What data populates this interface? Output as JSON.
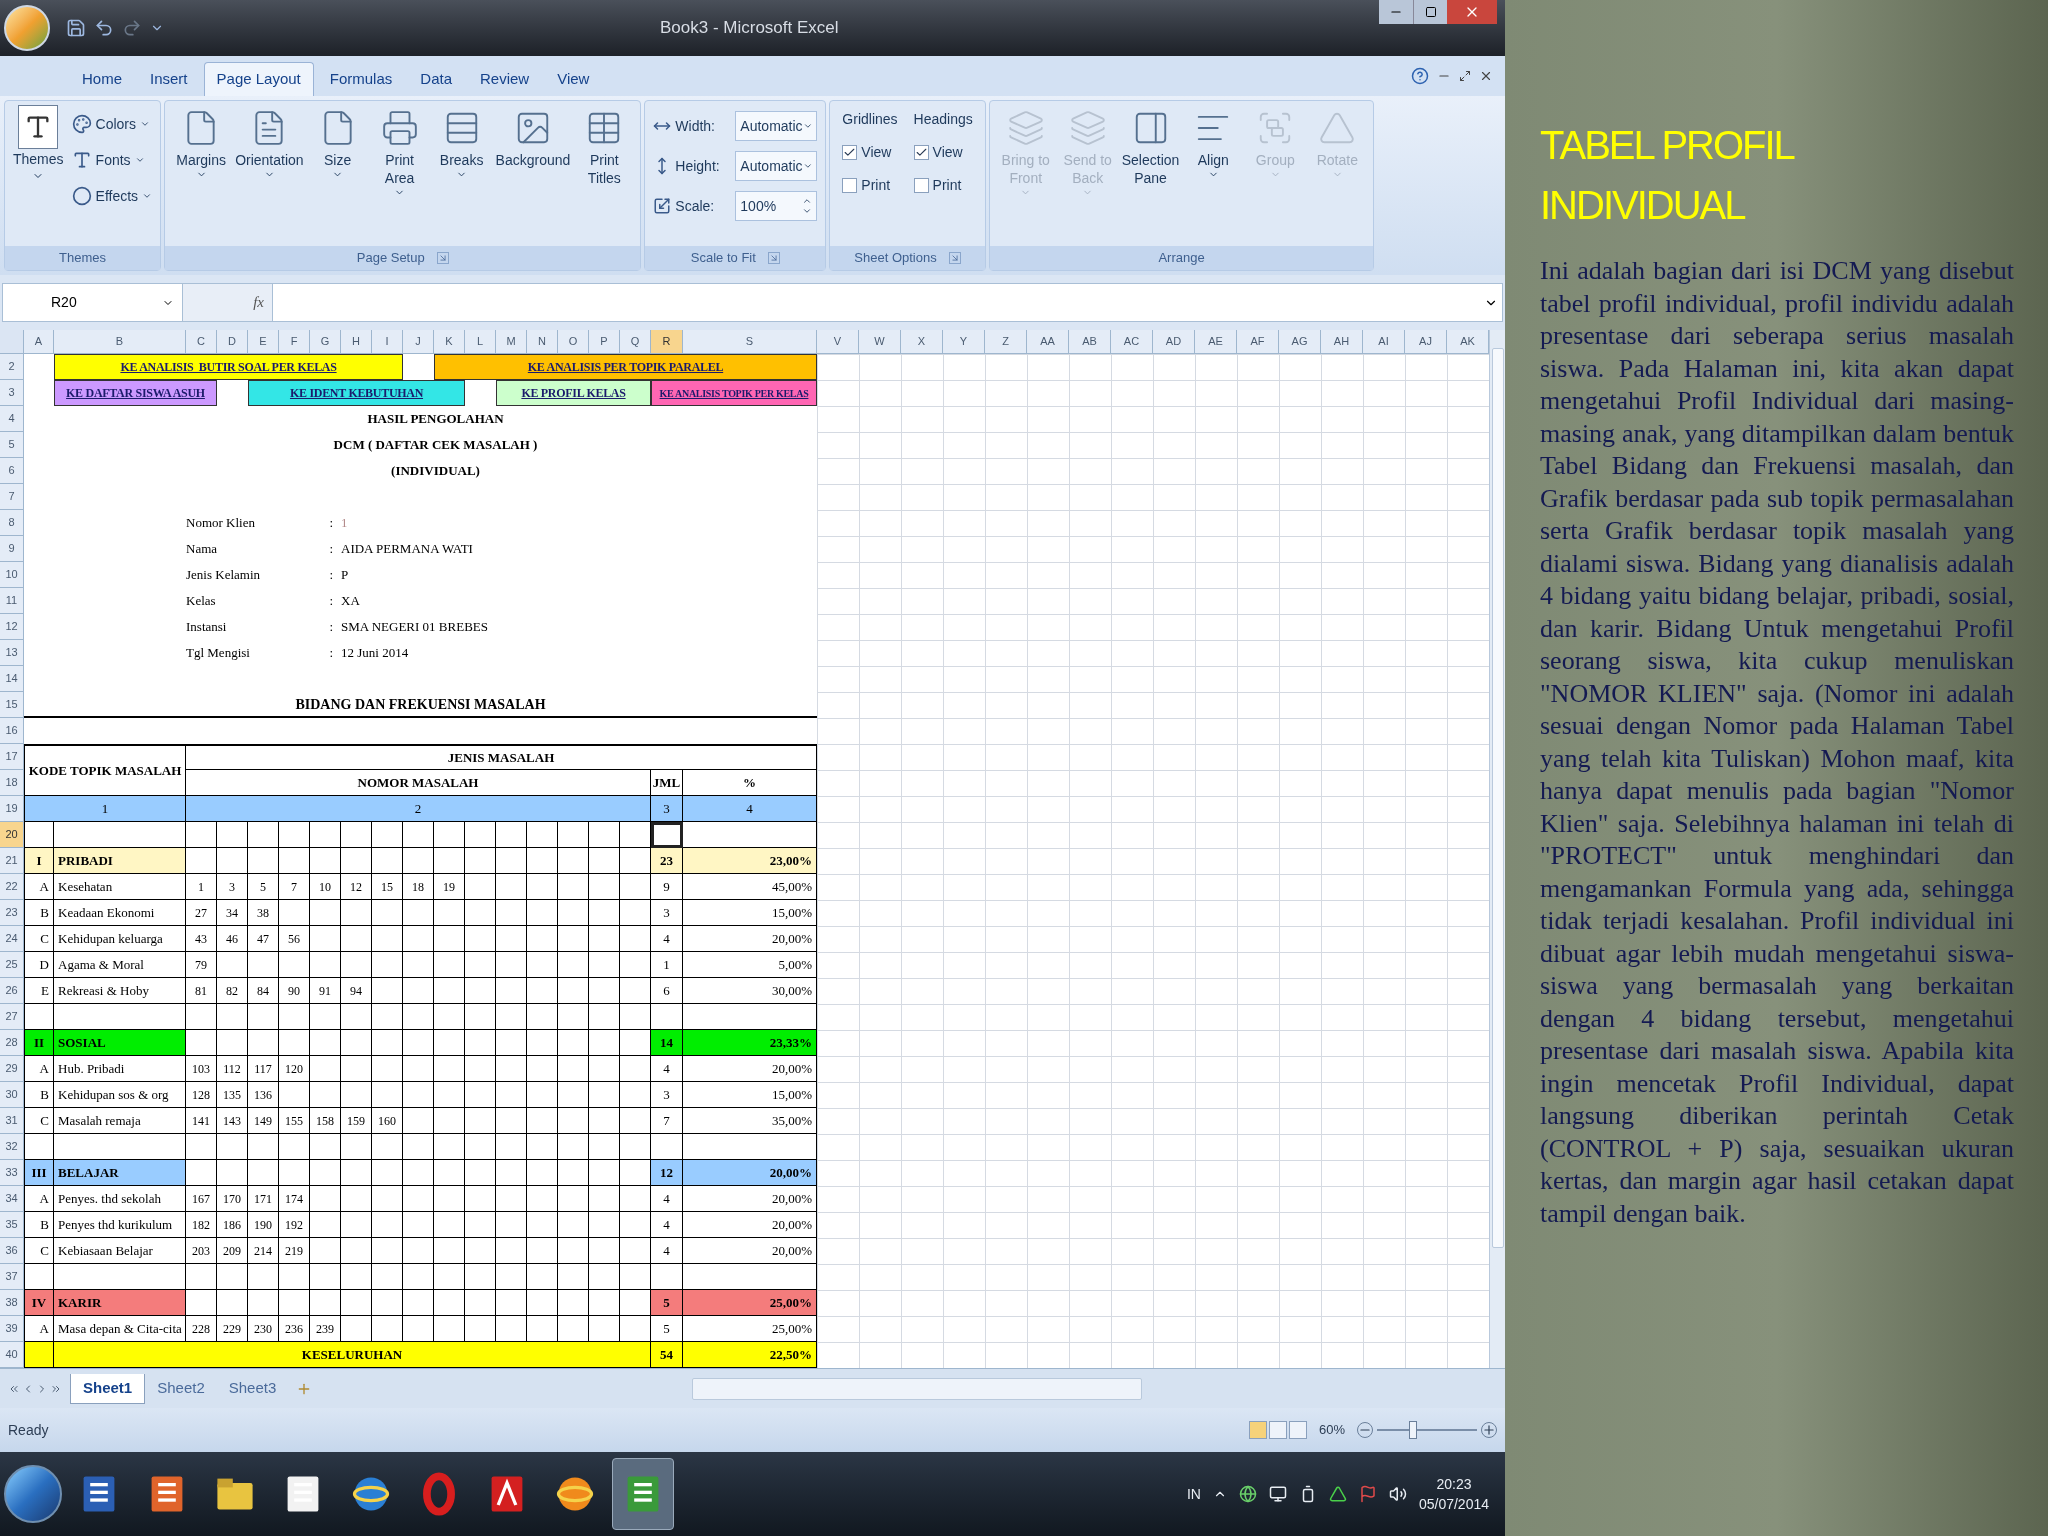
{
  "window": {
    "title": "Book3 - Microsoft Excel"
  },
  "ribbon_tabs": [
    {
      "label": "Home",
      "selected": false
    },
    {
      "label": "Insert",
      "selected": false
    },
    {
      "label": "Page Layout",
      "selected": true
    },
    {
      "label": "Formulas",
      "selected": false
    },
    {
      "label": "Data",
      "selected": false
    },
    {
      "label": "Review",
      "selected": false
    },
    {
      "label": "View",
      "selected": false
    }
  ],
  "ribbon_groups": [
    {
      "kind": "themes",
      "label": "Themes",
      "main": "Themes",
      "menus": [
        "Colors",
        "Fonts",
        "Effects"
      ]
    },
    {
      "kind": "buttons",
      "label": "Page Setup",
      "launcher": true,
      "buttons": [
        {
          "label": "Margins",
          "has_menu": true,
          "disabled": false
        },
        {
          "label": "Orientation",
          "has_menu": true,
          "disabled": false
        },
        {
          "label": "Size",
          "has_menu": true,
          "disabled": false
        },
        {
          "label": "Print Area",
          "has_menu": true,
          "disabled": false
        },
        {
          "label": "Breaks",
          "has_menu": true,
          "disabled": false
        },
        {
          "label": "Background",
          "has_menu": false,
          "disabled": false
        },
        {
          "label": "Print Titles",
          "has_menu": false,
          "disabled": false
        }
      ]
    },
    {
      "kind": "scale",
      "label": "Scale to Fit",
      "launcher": true,
      "fields": [
        {
          "kind": "dropdown",
          "label": "Width:",
          "value": "Automatic"
        },
        {
          "kind": "dropdown",
          "label": "Height:",
          "value": "Automatic"
        },
        {
          "kind": "spinner",
          "label": "Scale:",
          "value": "100%"
        }
      ]
    },
    {
      "kind": "sheet_options",
      "label": "Sheet Options",
      "launcher": true,
      "columns": [
        {
          "title": "Gridlines",
          "checks": [
            {
              "label": "View",
              "checked": true
            },
            {
              "label": "Print",
              "checked": false
            }
          ]
        },
        {
          "title": "Headings",
          "checks": [
            {
              "label": "View",
              "checked": true
            },
            {
              "label": "Print",
              "checked": false
            }
          ]
        }
      ]
    },
    {
      "kind": "buttons",
      "label": "Arrange",
      "launcher": false,
      "buttons": [
        {
          "label": "Bring to Front",
          "has_menu": true,
          "disabled": true
        },
        {
          "label": "Send to Back",
          "has_menu": true,
          "disabled": true
        },
        {
          "label": "Selection Pane",
          "has_menu": false,
          "disabled": false
        },
        {
          "label": "Align",
          "has_menu": true,
          "disabled": false
        },
        {
          "label": "Group",
          "has_menu": true,
          "disabled": true
        },
        {
          "label": "Rotate",
          "has_menu": true,
          "disabled": true
        }
      ]
    }
  ],
  "formula_bar": {
    "name_box": "R20",
    "fx": "fx"
  },
  "sheet": {
    "column_headers": [
      {
        "label": "A",
        "selected": false
      },
      {
        "label": "B",
        "selected": false
      },
      {
        "label": "C",
        "selected": false
      },
      {
        "label": "D",
        "selected": false
      },
      {
        "label": "E",
        "selected": false
      },
      {
        "label": "F",
        "selected": false
      },
      {
        "label": "G",
        "selected": false
      },
      {
        "label": "H",
        "selected": false
      },
      {
        "label": "I",
        "selected": false
      },
      {
        "label": "J",
        "selected": false
      },
      {
        "label": "K",
        "selected": false
      },
      {
        "label": "L",
        "selected": false
      },
      {
        "label": "M",
        "selected": false
      },
      {
        "label": "N",
        "selected": false
      },
      {
        "label": "O",
        "selected": false
      },
      {
        "label": "P",
        "selected": false
      },
      {
        "label": "Q",
        "selected": false
      },
      {
        "label": "R",
        "selected": true
      },
      {
        "label": "S",
        "selected": false
      },
      {
        "label": "V",
        "selected": false
      },
      {
        "label": "W",
        "selected": false
      },
      {
        "label": "X",
        "selected": false
      },
      {
        "label": "Y",
        "selected": false
      },
      {
        "label": "Z",
        "selected": false
      },
      {
        "label": "AA",
        "selected": false
      },
      {
        "label": "AB",
        "selected": false
      },
      {
        "label": "AC",
        "selected": false
      },
      {
        "label": "AD",
        "selected": false
      },
      {
        "label": "AE",
        "selected": false
      },
      {
        "label": "AF",
        "selected": false
      },
      {
        "label": "AG",
        "selected": false
      },
      {
        "label": "AH",
        "selected": false
      },
      {
        "label": "AI",
        "selected": false
      },
      {
        "label": "AJ",
        "selected": false
      },
      {
        "label": "AK",
        "selected": false
      }
    ],
    "row_headers": [
      {
        "label": "2",
        "selected": false
      },
      {
        "label": "3",
        "selected": false
      },
      {
        "label": "4",
        "selected": false
      },
      {
        "label": "5",
        "selected": false
      },
      {
        "label": "6",
        "selected": false
      },
      {
        "label": "7",
        "selected": false
      },
      {
        "label": "8",
        "selected": false
      },
      {
        "label": "9",
        "selected": false
      },
      {
        "label": "10",
        "selected": false
      },
      {
        "label": "11",
        "selected": false
      },
      {
        "label": "12",
        "selected": false
      },
      {
        "label": "13",
        "selected": false
      },
      {
        "label": "14",
        "selected": false
      },
      {
        "label": "15",
        "selected": false
      },
      {
        "label": "16",
        "selected": false
      },
      {
        "label": "17",
        "selected": false
      },
      {
        "label": "18",
        "selected": false
      },
      {
        "label": "19",
        "selected": false
      },
      {
        "label": "20",
        "selected": true
      },
      {
        "label": "21",
        "selected": false
      },
      {
        "label": "22",
        "selected": false
      },
      {
        "label": "23",
        "selected": false
      },
      {
        "label": "24",
        "selected": false
      },
      {
        "label": "25",
        "selected": false
      },
      {
        "label": "26",
        "selected": false
      },
      {
        "label": "27",
        "selected": false
      },
      {
        "label": "28",
        "selected": false
      },
      {
        "label": "29",
        "selected": false
      },
      {
        "label": "30",
        "selected": false
      },
      {
        "label": "31",
        "selected": false
      },
      {
        "label": "32",
        "selected": false
      },
      {
        "label": "33",
        "selected": false
      },
      {
        "label": "34",
        "selected": false
      },
      {
        "label": "35",
        "selected": false
      },
      {
        "label": "36",
        "selected": false
      },
      {
        "label": "37",
        "selected": false
      },
      {
        "label": "38",
        "selected": false
      },
      {
        "label": "39",
        "selected": false
      },
      {
        "label": "40",
        "selected": false
      }
    ],
    "links": [
      {
        "label": "KE ANALISIS  BUTIR SOAL PER KELAS",
        "color": "#ffff00"
      },
      {
        "label": "KE ANALISIS PER TOPIK PARALEL",
        "color": "#ffc000"
      },
      {
        "label": "KE DAFTAR SISWA ASUH",
        "color": "#cc99ff"
      },
      {
        "label": "KE IDENT KEBUTUHAN",
        "color": "#33e6e6"
      },
      {
        "label": "KE PROFIL KELAS",
        "color": "#ccffcc"
      },
      {
        "label": "KE ANALISIS TOPIK PER KELAS",
        "color": "#ff66b3"
      }
    ],
    "report_title": [
      "HASIL PENGOLAHAN",
      "DCM ( DAFTAR CEK MASALAH )",
      "(INDIVIDUAL)"
    ],
    "client_info": [
      {
        "label": "Nomor Klien",
        "separator": ":",
        "value": "1"
      },
      {
        "label": "Nama",
        "separator": ":",
        "value": "AIDA PERMANA WATI"
      },
      {
        "label": "Jenis Kelamin",
        "separator": ":",
        "value": "P"
      },
      {
        "label": "Kelas",
        "separator": ":",
        "value": "XA"
      },
      {
        "label": "Instansi",
        "separator": ":",
        "value": "SMA NEGERI 01 BREBES"
      },
      {
        "label": "Tgl Mengisi",
        "separator": ":",
        "value": "12 Juni 2014"
      }
    ],
    "section_title": "BIDANG DAN FREKUENSI MASALAH",
    "table": {
      "header_code": "KODE TOPIK MASALAH",
      "header_type": "JENIS MASALAH",
      "header_numbers": "NOMOR MASALAH",
      "header_count": "JML",
      "header_percent": "%",
      "index_row": [
        "1",
        "2",
        "3",
        "4"
      ],
      "groups": [
        {
          "code": "I",
          "name": "PRIBADI",
          "color": "#fff6c4",
          "count": "23",
          "percent": "23,00%",
          "items": [
            {
              "code": "A",
              "name": "Kesehatan",
              "numbers": [
                "1",
                "3",
                "5",
                "7",
                "10",
                "12",
                "15",
                "18",
                "19"
              ],
              "count": "9",
              "percent": "45,00%"
            },
            {
              "code": "B",
              "name": "Keadaan Ekonomi",
              "numbers": [
                "27",
                "34",
                "38"
              ],
              "count": "3",
              "percent": "15,00%"
            },
            {
              "code": "C",
              "name": "Kehidupan keluarga",
              "numbers": [
                "43",
                "46",
                "47",
                "56"
              ],
              "count": "4",
              "percent": "20,00%"
            },
            {
              "code": "D",
              "name": "Agama & Moral",
              "numbers": [
                "79"
              ],
              "count": "1",
              "percent": "5,00%"
            },
            {
              "code": "E",
              "name": "Rekreasi & Hoby",
              "numbers": [
                "81",
                "82",
                "84",
                "90",
                "91",
                "94"
              ],
              "count": "6",
              "percent": "30,00%"
            }
          ]
        },
        {
          "code": "II",
          "name": "SOSIAL",
          "color": "#00ee00",
          "count": "14",
          "percent": "23,33%",
          "items": [
            {
              "code": "A",
              "name": "Hub. Pribadi",
              "numbers": [
                "103",
                "112",
                "117",
                "120"
              ],
              "count": "4",
              "percent": "20,00%"
            },
            {
              "code": "B",
              "name": "Kehidupan sos & org",
              "numbers": [
                "128",
                "135",
                "136"
              ],
              "count": "3",
              "percent": "15,00%"
            },
            {
              "code": "C",
              "name": "Masalah remaja",
              "numbers": [
                "141",
                "143",
                "149",
                "155",
                "158",
                "159",
                "160"
              ],
              "count": "7",
              "percent": "35,00%"
            }
          ]
        },
        {
          "code": "III",
          "name": "BELAJAR",
          "color": "#99ccff",
          "count": "12",
          "percent": "20,00%",
          "items": [
            {
              "code": "A",
              "name": "Penyes. thd sekolah",
              "numbers": [
                "167",
                "170",
                "171",
                "174"
              ],
              "count": "4",
              "percent": "20,00%"
            },
            {
              "code": "B",
              "name": "Penyes thd kurikulum",
              "numbers": [
                "182",
                "186",
                "190",
                "192"
              ],
              "count": "4",
              "percent": "20,00%"
            },
            {
              "code": "C",
              "name": "Kebiasaan Belajar",
              "numbers": [
                "203",
                "209",
                "214",
                "219"
              ],
              "count": "4",
              "percent": "20,00%"
            }
          ]
        },
        {
          "code": "IV",
          "name": "KARIR",
          "color": "#f47c7c",
          "count": "5",
          "percent": "25,00%",
          "items": [
            {
              "code": "A",
              "name": "Masa depan & Cita-cita",
              "numbers": [
                "228",
                "229",
                "230",
                "236",
                "239"
              ],
              "count": "5",
              "percent": "25,00%"
            }
          ]
        }
      ],
      "total": {
        "label": "KESELURUHAN",
        "count": "54",
        "percent": "22,50%"
      }
    }
  },
  "sheet_tabs": [
    {
      "label": "Sheet1",
      "selected": true
    },
    {
      "label": "Sheet2",
      "selected": false
    },
    {
      "label": "Sheet3",
      "selected": false
    }
  ],
  "status_bar": {
    "text": "Ready",
    "view_buttons": [
      {
        "selected": true
      },
      {
        "selected": false
      },
      {
        "selected": false
      }
    ],
    "zoom": "60%",
    "zoom_slider": {
      "level": 0.36
    }
  },
  "taskbar": {
    "apps": [
      {
        "selected": false
      },
      {
        "selected": false
      },
      {
        "selected": false
      },
      {
        "selected": false
      },
      {
        "selected": false
      },
      {
        "selected": false
      },
      {
        "selected": false
      },
      {
        "selected": false
      },
      {
        "selected": true
      }
    ],
    "language": "IN",
    "time": "20:23",
    "date": "05/07/2014"
  },
  "slide_text": {
    "title": "TABEL PROFIL INDIVIDUAL",
    "body": "Ini adalah bagian dari isi DCM yang disebut tabel profil individual, profil individu adalah presentase dari seberapa serius masalah siswa. Pada Halaman ini, kita akan dapat mengetahui Profil Individual dari masing-masing anak, yang ditampilkan dalam bentuk Tabel Bidang dan Frekuensi masalah, dan Grafik berdasar pada sub topik permasalahan serta Grafik berdasar topik masalah yang dialami siswa. Bidang yang dianalisis adalah 4 bidang yaitu bidang belajar, pribadi, sosial, dan karir. Bidang Untuk mengetahui Profil seorang siswa, kita cukup menuliskan \"NOMOR KLIEN\" saja. (Nomor ini adalah sesuai dengan Nomor pada Halaman Tabel yang telah kita Tuliskan) Mohon maaf, kita hanya dapat menulis pada bagian \"Nomor Klien\" saja. Selebihnya halaman ini telah di \"PROTECT\" untuk menghindari dan mengamankan Formula yang ada, sehingga tidak terjadi kesalahan. Profil individual ini dibuat agar lebih mudah mengetahui siswa-siswa yang bermasalah yang berkaitan dengan 4 bidang tersebut, mengetahui presentase dari masalah siswa. Apabila kita ingin mencetak Profil Individual, dapat langsung diberikan perintah Cetak (CONTROL + P) saja, sesuaikan ukuran kertas, dan margin agar hasil cetakan dapat tampil dengan baik."
  }
}
